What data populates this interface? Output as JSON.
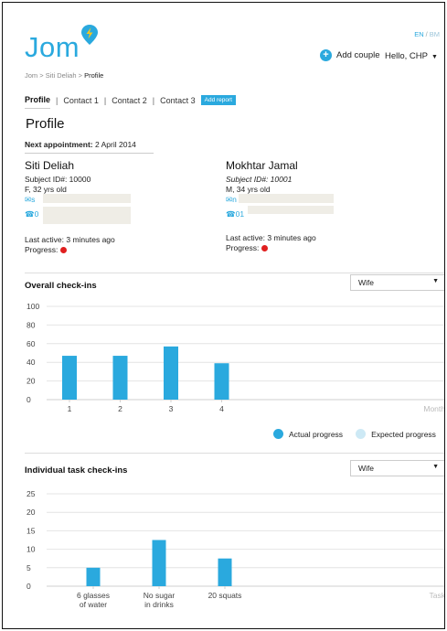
{
  "header": {
    "logo_text": "Jom",
    "lang_active": "EN",
    "lang_sep": "/",
    "lang_other": "BM",
    "add_couple_label": "Add couple",
    "user_greeting": "Hello, CHP"
  },
  "breadcrumb": {
    "home": "Jom",
    "sep": ">",
    "person": "Siti Deliah",
    "current": "Profile"
  },
  "tabs": [
    "Profile",
    "Contact 1",
    "Contact 2",
    "Contact 3"
  ],
  "tab_sep": "|",
  "add_report_label": "Add report",
  "page_title": "Profile",
  "next_appointment": {
    "label": "Next appointment:",
    "date": "2 April 2014"
  },
  "persons": [
    {
      "name": "Siti Deliah",
      "subject_id": "Subject ID#: 10000",
      "demographic": "F, 32 yrs old",
      "email_partial": "s",
      "phone_partial": "0",
      "last_active": "Last active: 3 minutes ago",
      "progress_label": "Progress:"
    },
    {
      "name": "Mokhtar Jamal",
      "subject_id": "Subject ID#: 10001",
      "demographic": "M, 34 yrs old",
      "email_partial": "n",
      "phone_partial": "01",
      "last_active": "Last active: 3 minutes ago",
      "progress_label": "Progress:"
    }
  ],
  "colors": {
    "accent": "#2aa9de",
    "expected": "#cde9f5",
    "progress_bad": "#e01f1f"
  },
  "icons": {
    "add": "plus-circle-icon",
    "email": "envelope-icon",
    "phone": "phone-icon",
    "dropdown": "caret-down-icon",
    "logo": "location-pin-bolt-icon"
  },
  "overall": {
    "title": "Overall check-ins",
    "filter_value": "Wife",
    "legend": [
      "Actual progress",
      "Expected progress"
    ]
  },
  "individual": {
    "title": "Individual task check-ins",
    "filter_value": "Wife"
  },
  "chart_data": [
    {
      "type": "bar",
      "title": "Overall check-ins",
      "categories": [
        "1",
        "2",
        "3",
        "4"
      ],
      "xlabel": "Month",
      "ylabel": "",
      "ylim": [
        0,
        100
      ],
      "yticks": [
        0,
        20,
        40,
        60,
        80,
        100
      ],
      "series": [
        {
          "name": "Actual progress",
          "values": [
            47,
            47,
            57,
            39
          ]
        },
        {
          "name": "Expected progress",
          "values": []
        }
      ],
      "grid": true,
      "legend_position": "bottom-right"
    },
    {
      "type": "bar",
      "title": "Individual task check-ins",
      "categories": [
        [
          "6 glasses",
          "of water"
        ],
        [
          "No sugar",
          "in drinks"
        ],
        [
          "20 squats"
        ]
      ],
      "xlabel": "Task",
      "ylabel": "",
      "ylim": [
        0,
        25
      ],
      "yticks": [
        0,
        5,
        10,
        15,
        20,
        25
      ],
      "values": [
        5,
        12.5,
        7.5
      ],
      "grid": true
    }
  ]
}
